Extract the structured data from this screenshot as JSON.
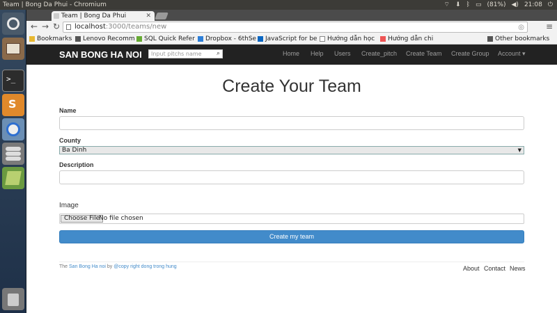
{
  "os": {
    "window_title": "Team | Bong Da Phui - Chromium",
    "battery": "(81%)",
    "time": "21:08"
  },
  "launcher": {
    "items": [
      "dash-icon",
      "files-icon",
      "terminal-icon",
      "sublime-icon",
      "chromium-icon",
      "database-icon",
      "book-icon",
      "trash-icon"
    ]
  },
  "browser": {
    "tab_title": "Team | Bong Da Phui",
    "url_host": "localhost",
    "url_path": ":3000/teams/new",
    "bookmarks": [
      "Bookmarks",
      "Lenovo Recomm",
      "SQL Quick Refer",
      "Dropbox - 6thSe",
      "JavaScript for be",
      "Hướng dẫn học",
      "Hướng dẫn chi",
      "Other bookmarks"
    ]
  },
  "site": {
    "brand": "SAN BONG HA NOI",
    "search_placeholder": "Input pitchs name",
    "nav": [
      "Home",
      "Help",
      "Users",
      "Create_pitch",
      "Create Team",
      "Create Group",
      "Account ▾"
    ]
  },
  "form": {
    "heading": "Create Your Team",
    "name_label": "Name",
    "name_value": "",
    "county_label": "County",
    "county_value": "Ba Dinh",
    "description_label": "Description",
    "description_value": "",
    "image_label": "Image",
    "file_button": "Choose File",
    "file_status": "No file chosen",
    "submit": "Create my team"
  },
  "footer": {
    "prefix": "The",
    "site_link": "San Bong Ha noi",
    "by": "by",
    "author_link": "@copy right dong trong hung",
    "links": [
      "About",
      "Contact",
      "News"
    ]
  },
  "colors": {
    "navbar": "#222222",
    "primary_button": "#428bca",
    "link": "#428bca"
  }
}
